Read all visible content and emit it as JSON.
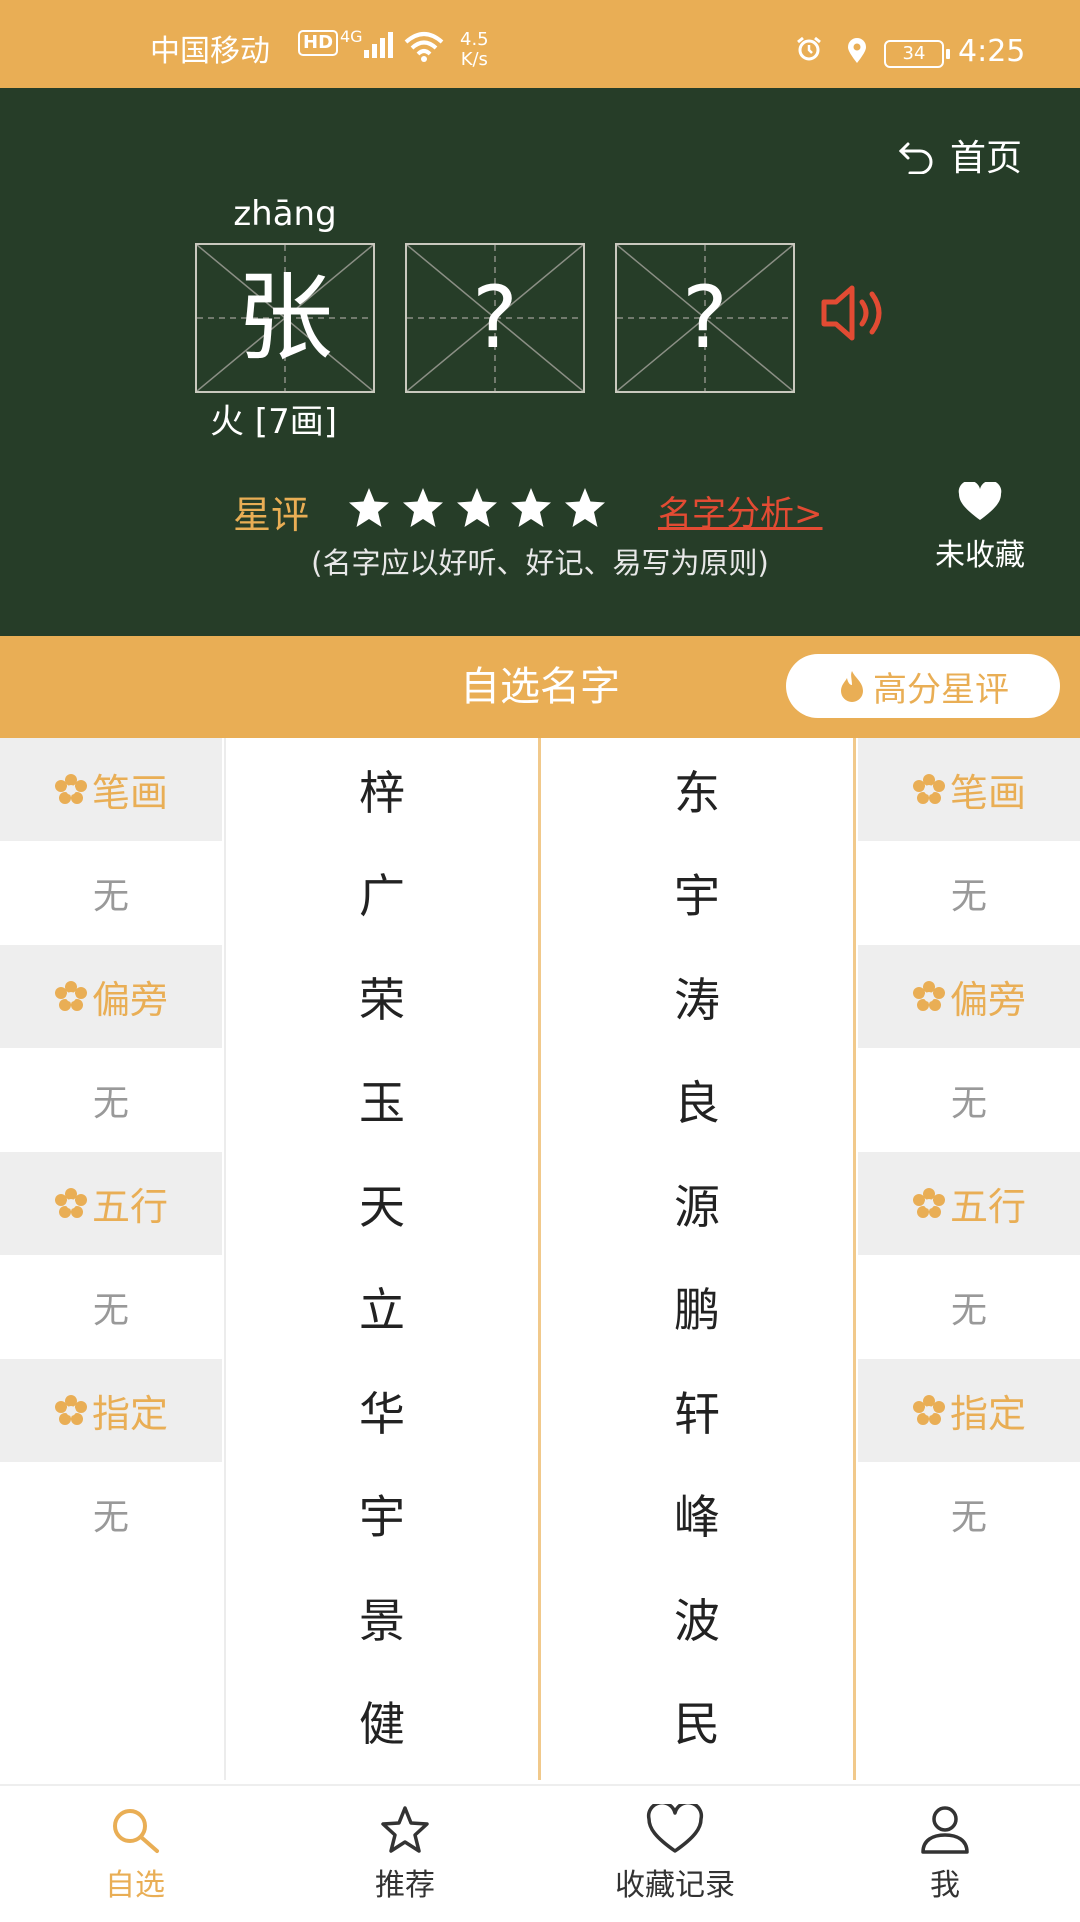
{
  "status_bar": {
    "carrier": "中国移动",
    "hd": "HD",
    "network": "4G",
    "speed_value": "4.5",
    "speed_unit": "K/s",
    "battery": "34",
    "time": "4:25"
  },
  "board": {
    "home_label": "首页",
    "pinyin": "zhāng",
    "surname": "张",
    "given_1": "?",
    "given_2": "?",
    "element_info": "火 [7画]",
    "rating_label": "星评",
    "rating_stars": 5,
    "analysis_link": "名字分析>",
    "favorite_label": "未收藏",
    "hint": "(名字应以好听、好记、易写为原则)"
  },
  "section": {
    "title": "自选名字",
    "high_rating_button": "高分星评"
  },
  "filters": [
    {
      "label": "笔画",
      "value": "无"
    },
    {
      "label": "偏旁",
      "value": "无"
    },
    {
      "label": "五行",
      "value": "无"
    },
    {
      "label": "指定",
      "value": "无"
    }
  ],
  "names_col1": [
    "梓",
    "广",
    "荣",
    "玉",
    "天",
    "立",
    "华",
    "宇",
    "景",
    "健"
  ],
  "names_col2": [
    "东",
    "宇",
    "涛",
    "良",
    "源",
    "鹏",
    "轩",
    "峰",
    "波",
    "民"
  ],
  "tabs": [
    {
      "label": "自选",
      "icon": "search-icon",
      "active": true
    },
    {
      "label": "推荐",
      "icon": "star-icon",
      "active": false
    },
    {
      "label": "收藏记录",
      "icon": "heart-icon",
      "active": false
    },
    {
      "label": "我",
      "icon": "user-icon",
      "active": false
    }
  ],
  "colors": {
    "accent": "#E9AE55",
    "board": "#263D28",
    "link": "#E24B33"
  }
}
